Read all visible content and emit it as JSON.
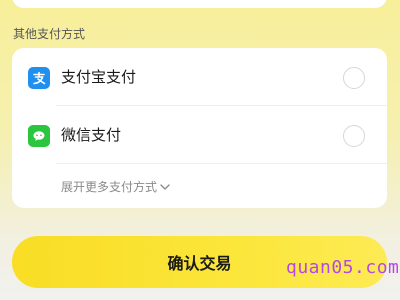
{
  "section": {
    "title": "其他支付方式"
  },
  "payment_methods": [
    {
      "label": "支付宝支付",
      "icon": "alipay-icon",
      "color": "#1f8ff0",
      "selected": false
    },
    {
      "label": "微信支付",
      "icon": "wechat-icon",
      "color": "#2bc53e",
      "selected": false
    }
  ],
  "expand": {
    "label": "展开更多支付方式",
    "icon": "chevron-down-icon"
  },
  "confirm": {
    "label": "确认交易",
    "color": "#fbe030"
  },
  "watermark": {
    "text": "quan05.com",
    "color": "#b548e6"
  }
}
